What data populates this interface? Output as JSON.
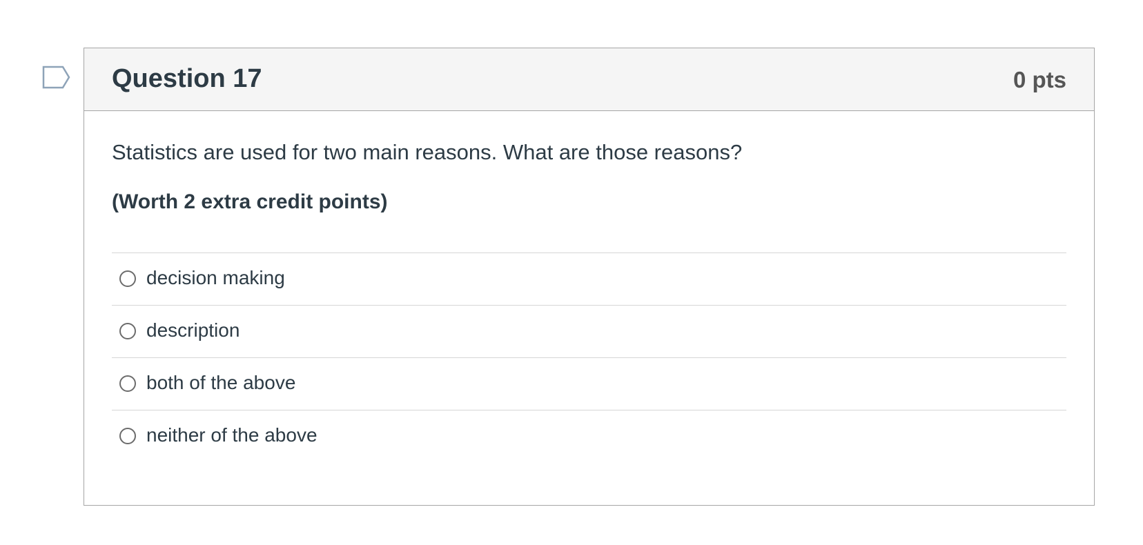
{
  "question": {
    "title": "Question 17",
    "points": "0 pts",
    "flag_icon": "flag-bookmark-icon",
    "prompt": "Statistics are used for two main reasons. What are those reasons?",
    "note": "(Worth 2 extra credit points)",
    "answers": [
      {
        "label": "decision making",
        "selected": false
      },
      {
        "label": "description",
        "selected": false
      },
      {
        "label": "both of the above",
        "selected": false
      },
      {
        "label": "neither of the above",
        "selected": false
      }
    ]
  },
  "colors": {
    "text": "#2d3b45",
    "header_bg": "#f5f5f5",
    "border": "#a5a5a5",
    "flag": "#8ea3b8"
  }
}
